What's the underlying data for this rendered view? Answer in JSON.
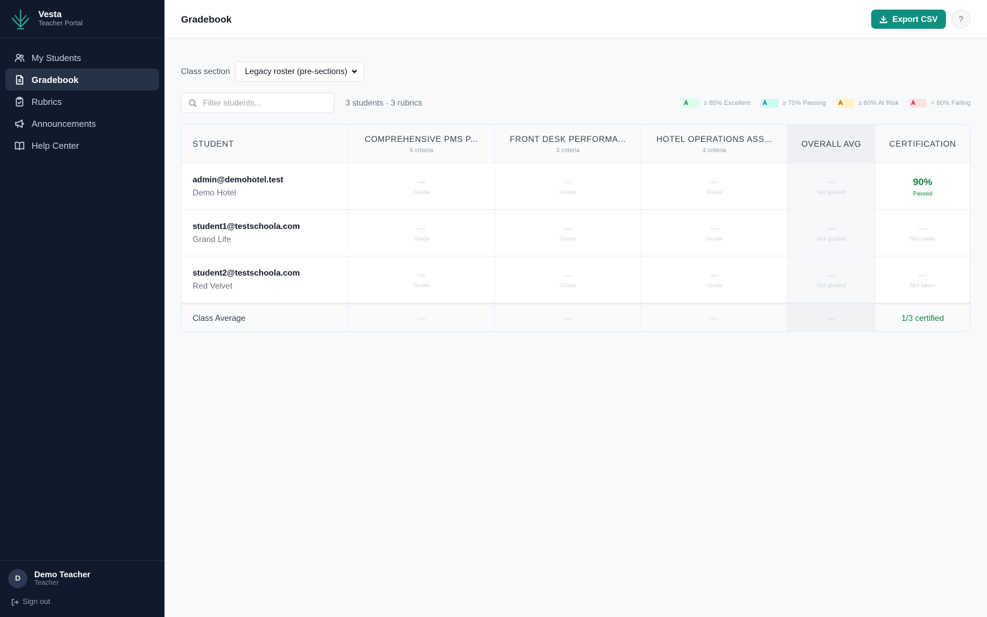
{
  "brand": {
    "name": "Vesta",
    "subtitle": "Teacher Portal"
  },
  "nav": [
    {
      "label": "My Students",
      "icon": "users-icon"
    },
    {
      "label": "Gradebook",
      "icon": "gradebook-icon",
      "active": true
    },
    {
      "label": "Rubrics",
      "icon": "clipboard-icon"
    },
    {
      "label": "Announcements",
      "icon": "megaphone-icon"
    },
    {
      "label": "Help Center",
      "icon": "book-icon"
    }
  ],
  "user": {
    "initial": "D",
    "name": "Demo Teacher",
    "role": "Teacher",
    "signout": "Sign out"
  },
  "header": {
    "title": "Gradebook",
    "export_label": "Export CSV",
    "help_label": "?"
  },
  "section": {
    "label": "Class section",
    "selected": "Legacy roster (pre-sections)"
  },
  "filter": {
    "placeholder": "Filter students...",
    "count": "3 students · 3 rubrics"
  },
  "legend": [
    {
      "chip": "A",
      "text": "≥ 85% Excellent",
      "bg": "#dcfce7",
      "fg": "#15803d"
    },
    {
      "chip": "A",
      "text": "≥ 75% Passing",
      "bg": "#ccfbf1",
      "fg": "#0f766e"
    },
    {
      "chip": "A",
      "text": "≥ 60% At Risk",
      "bg": "#fef3c7",
      "fg": "#b45309"
    },
    {
      "chip": "A",
      "text": "< 60% Failing",
      "bg": "#fee2e2",
      "fg": "#b91c1c"
    }
  ],
  "table": {
    "headers": {
      "student": "Student",
      "rubrics": [
        {
          "title": "COMPREHENSIVE PMS P...",
          "criteria": "6 criteria"
        },
        {
          "title": "FRONT DESK PERFORMA...",
          "criteria": "3 criteria"
        },
        {
          "title": "HOTEL OPERATIONS ASS...",
          "criteria": "4 criteria"
        }
      ],
      "overall": "Overall Avg",
      "certification": "Certification"
    },
    "rows": [
      {
        "email": "admin@demohotel.test",
        "hotel": "Demo Hotel",
        "grades": [
          "—",
          "—",
          "—"
        ],
        "grade_caption": "Grade",
        "overall": "—",
        "overall_caption": "Not graded",
        "cert_value": "90%",
        "cert_caption": "Passed"
      },
      {
        "email": "student1@testschoola.com",
        "hotel": "Grand Life",
        "grades": [
          "—",
          "—",
          "—"
        ],
        "grade_caption": "Grade",
        "overall": "—",
        "overall_caption": "Not graded",
        "cert_value": "—",
        "cert_caption": "Not taken"
      },
      {
        "email": "student2@testschoola.com",
        "hotel": "Red Velvet",
        "grades": [
          "—",
          "—",
          "—"
        ],
        "grade_caption": "Grade",
        "overall": "—",
        "overall_caption": "Not graded",
        "cert_value": "—",
        "cert_caption": "Not taken"
      }
    ],
    "average": {
      "label": "Class Average",
      "grades": [
        "—",
        "—",
        "—"
      ],
      "overall": "—",
      "certification": "1/3 certified"
    }
  },
  "colors": {
    "accent": "#0f8f7e",
    "sidebar": "#111a2c",
    "pass": "#15803d"
  }
}
